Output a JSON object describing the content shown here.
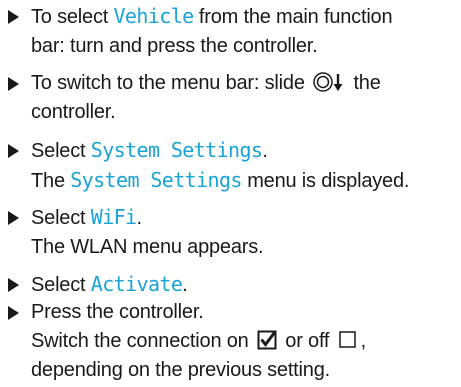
{
  "steps": [
    {
      "pre": "To select ",
      "ui": "Vehicle",
      "post_line1": " from the main function",
      "line2": "bar: turn and press the controller."
    },
    {
      "line1_pre": "To switch to the menu bar: slide ",
      "icon": "controller-slide-down-icon",
      "line1_post": " the",
      "line2": "controller."
    },
    {
      "pre": "Select ",
      "ui": "System Settings",
      "post": ".",
      "result_ui_pre": "The ",
      "result_ui": "System Settings",
      "result_post": " menu is displayed."
    },
    {
      "pre": "Select ",
      "ui": "WiFi",
      "post": ".",
      "result": "The WLAN menu appears."
    },
    {
      "pre": "Select ",
      "ui": "Activate",
      "post": "."
    },
    {
      "line1": "Press the controller.",
      "line2_pre": "Switch the connection on ",
      "on_icon": "checked-box-icon",
      "line2_mid": " or off ",
      "off_icon": "empty-box-icon",
      "line2_post": ",",
      "line3": "depending on the previous setting."
    }
  ],
  "colors": {
    "ui_text": "#1aa3d6",
    "body_text": "#1a1a1a"
  }
}
